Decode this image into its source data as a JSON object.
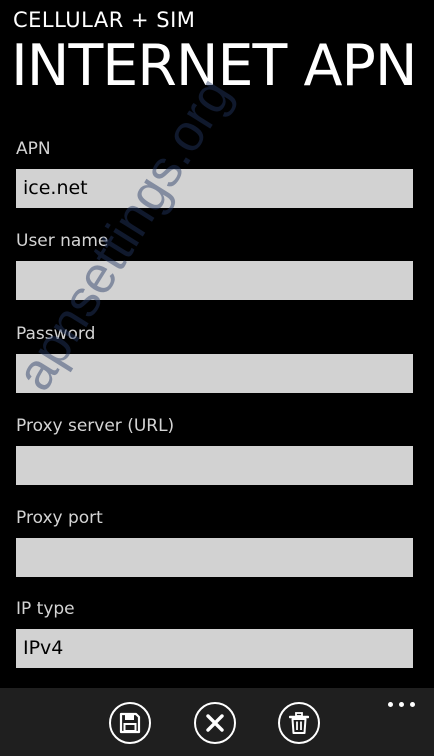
{
  "header": {
    "app_title": "CELLULAR + SIM",
    "page_title": "INTERNET APN"
  },
  "fields": [
    {
      "label": "APN",
      "value": "ice.net"
    },
    {
      "label": "User name",
      "value": ""
    },
    {
      "label": "Password",
      "value": ""
    },
    {
      "label": "Proxy server (URL)",
      "value": ""
    },
    {
      "label": "Proxy port",
      "value": ""
    },
    {
      "label": "IP type",
      "value": "IPv4"
    }
  ],
  "watermark": "apnsettings.org",
  "app_bar": {
    "buttons": [
      {
        "icon": "save-icon"
      },
      {
        "icon": "cancel-icon"
      },
      {
        "icon": "delete-icon"
      }
    ],
    "more_icon": "more-icon"
  },
  "colors": {
    "background": "#000000",
    "field_background": "#d2d2d2",
    "app_bar_background": "#1f1f1f",
    "foreground": "#ffffff"
  }
}
